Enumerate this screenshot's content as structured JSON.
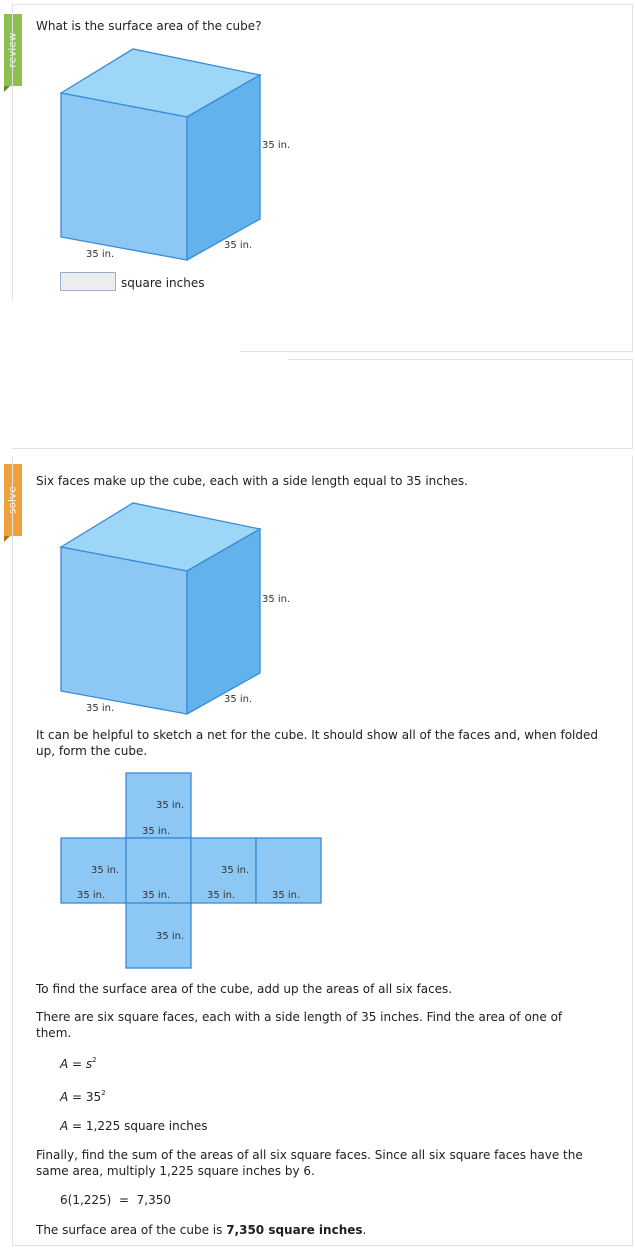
{
  "tabs": {
    "review": "review",
    "solve": "solve"
  },
  "review": {
    "question": "What is the surface area of the cube?",
    "cube_labels": {
      "height": "35 in.",
      "depth": "35 in.",
      "width": "35 in."
    },
    "unit_label": "square inches",
    "answer_value": ""
  },
  "solve": {
    "intro": "Six faces make up the cube, each with a side length equal to 35 inches.",
    "cube_labels": {
      "height": "35 in.",
      "depth": "35 in.",
      "width": "35 in."
    },
    "net_text": "It can be helpful to sketch a net for the cube. It should show all of the faces and, when folded up, form the cube.",
    "net_labels": {
      "top_side": "35 in.",
      "top_bottom": "35 in.",
      "left_side": "35 in.",
      "left_bottom": "35 in.",
      "center_bottom": "35 in.",
      "right_side": "35 in.",
      "right_bottom": "35 in.",
      "far_right_bottom": "35 in.",
      "lower_side": "35 in."
    },
    "step1": "To find the surface area of the cube, add up the areas of all six faces.",
    "step2": "There are six square faces, each with a side length of 35 inches. Find the area of one of them.",
    "formula": {
      "lhs": "A",
      "eq": " = ",
      "var": "s",
      "exp": "2"
    },
    "substitution": {
      "lhs": "A",
      "eq": " = ",
      "base": "35",
      "exp": "2"
    },
    "area_result": {
      "lhs": "A",
      "rest": " = 1,225 square inches"
    },
    "step3": "Finally, find the sum of the areas of all six square faces. Since all six square faces have the same area, multiply 1,225 square inches by 6.",
    "product": "6(1,225)  =  7,350",
    "conclusion_prefix": "The surface area of the cube is ",
    "conclusion_bold": "7,350 square inches",
    "conclusion_suffix": "."
  },
  "colors": {
    "cube_top": "#9dd6f7",
    "cube_front": "#8dc8f4",
    "cube_side": "#62b3ec",
    "cube_edge": "#3a8ad6",
    "review_tab": "#8cc152",
    "solve_tab": "#f0a13c"
  }
}
